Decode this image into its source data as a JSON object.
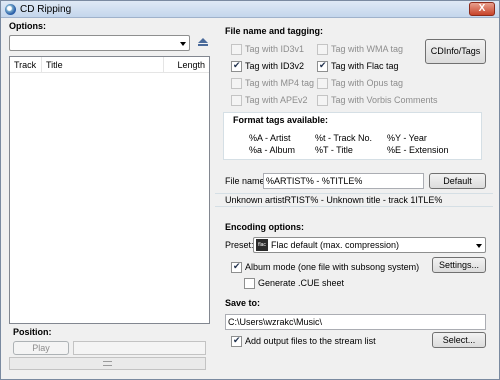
{
  "window": {
    "title": "CD Ripping",
    "close_glyph": "X"
  },
  "left": {
    "options_label": "Options:",
    "drive_select": "",
    "track_columns": [
      "Track",
      "Title",
      "Length"
    ],
    "position_label": "Position:",
    "play_label": "Play"
  },
  "tagging": {
    "header": "File name and tagging:",
    "checkboxes": [
      {
        "label": "Tag with ID3v1",
        "checked": false,
        "enabled": false
      },
      {
        "label": "Tag with WMA tag",
        "checked": false,
        "enabled": false
      },
      {
        "label": "Tag with ID3v2",
        "checked": true,
        "enabled": true
      },
      {
        "label": "Tag with Flac tag",
        "checked": true,
        "enabled": true
      },
      {
        "label": "Tag with MP4 tag",
        "checked": false,
        "enabled": false
      },
      {
        "label": "Tag with Opus tag",
        "checked": false,
        "enabled": false
      },
      {
        "label": "Tag with APEv2",
        "checked": false,
        "enabled": false
      },
      {
        "label": "Tag with Vorbis Comments",
        "checked": false,
        "enabled": false
      }
    ],
    "cdinfo_button": "CDInfo/Tags",
    "format_header": "Format tags available:",
    "format_tags": [
      "%A - Artist",
      "%t - Track No.",
      "%Y - Year",
      "%a - Album",
      "%T - Title",
      "%E - Extension"
    ],
    "filename_label": "File name:",
    "filename_value": "%ARTIST% - %TITLE%",
    "default_button": "Default",
    "preview": "Unknown artistRTIST% - Unknown title - track 1ITLE%"
  },
  "encoding": {
    "header": "Encoding options:",
    "preset_label": "Preset:",
    "preset_icon_text": "flac",
    "preset_value": "Flac default (max. compression)",
    "album_mode": {
      "label": "Album mode (one file with subsong system)",
      "checked": true
    },
    "cue_sheet": {
      "label": "Generate .CUE sheet",
      "checked": false
    },
    "settings_button": "Settings..."
  },
  "save": {
    "header": "Save to:",
    "path": "C:\\Users\\wzrakc\\Music\\",
    "add_to_list": {
      "label": "Add output files to the stream list",
      "checked": true
    },
    "select_button": "Select..."
  }
}
